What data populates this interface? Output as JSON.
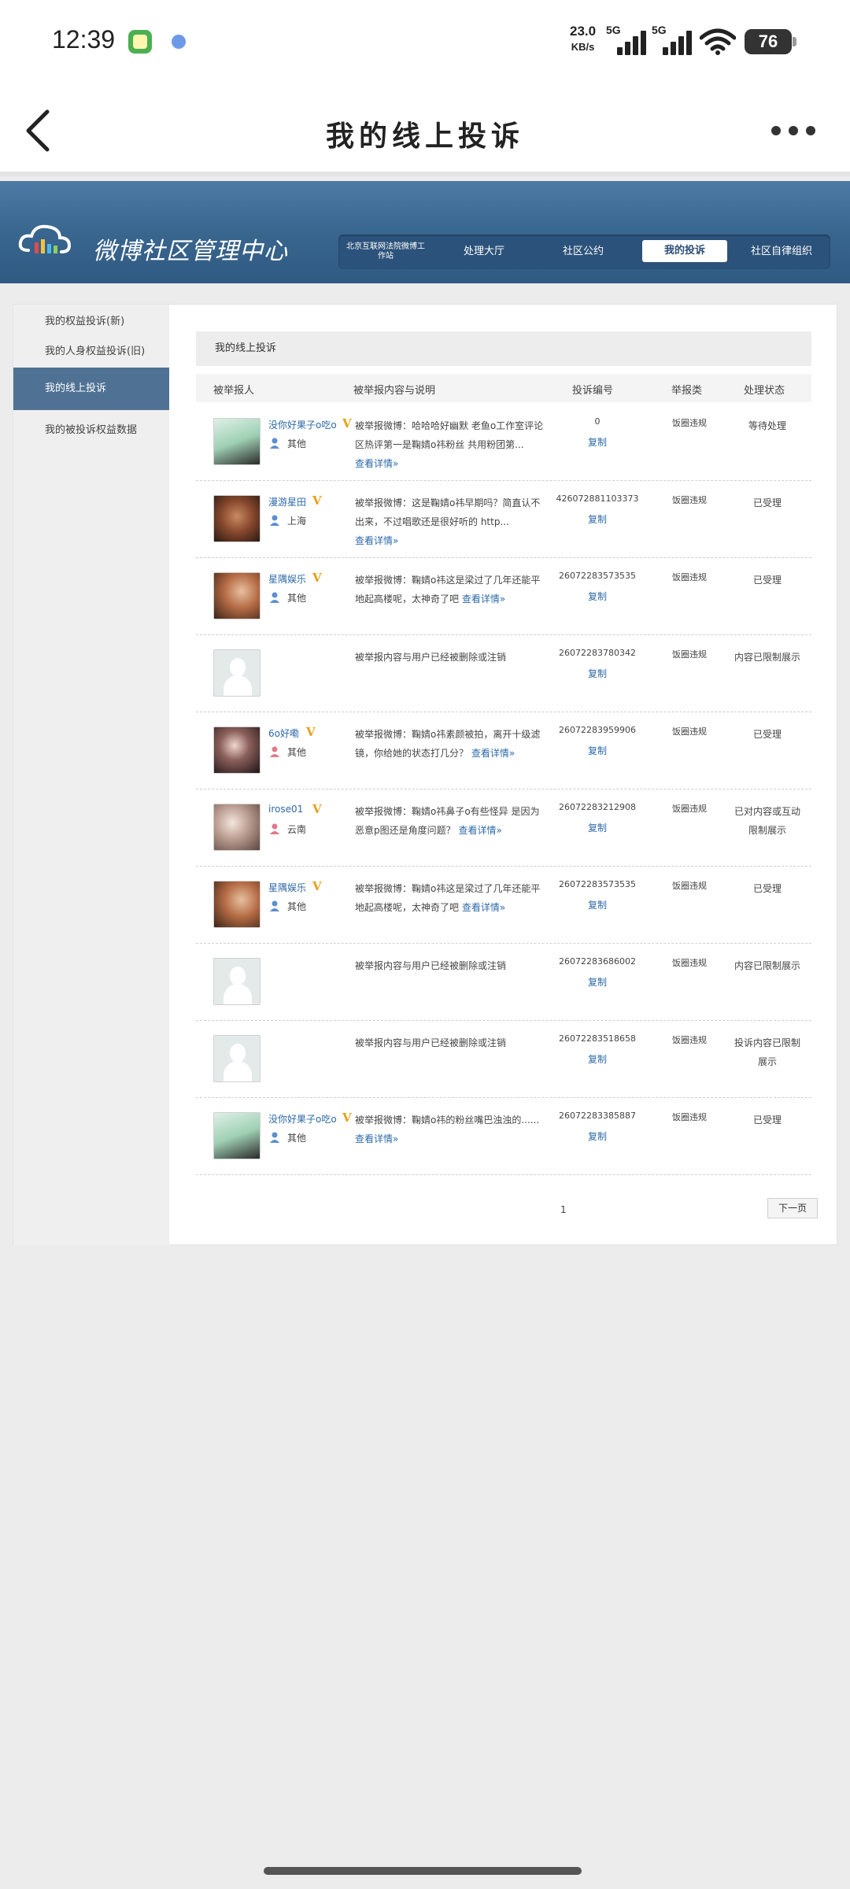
{
  "status_bar": {
    "time": "12:39",
    "net_speed_value": "23.0",
    "net_speed_unit": "KB/s",
    "net_type_1": "5G",
    "net_type_2": "5G",
    "battery": "76"
  },
  "app_bar": {
    "title": "我的线上投诉"
  },
  "banner": {
    "logo_text": "微博社区管理中心",
    "nav": [
      "北京互联网法院微博工作站",
      "处理大厅",
      "社区公约",
      "我的投诉",
      "社区自律组织"
    ],
    "active_nav": "我的投诉"
  },
  "sidebar": {
    "items": [
      "我的权益投诉(新)",
      "我的人身权益投诉(旧)",
      "我的线上投诉",
      "我的被投诉权益数据"
    ]
  },
  "content": {
    "section_title": "我的线上投诉",
    "columns": [
      "被举报人",
      "被举报内容与说明",
      "投诉编号",
      "举报类",
      "处理状态"
    ],
    "copy_label": "复制",
    "detail_label": "查看详情»",
    "rows": [
      {
        "name": "没你好果子o吃o",
        "location": "其他",
        "desc": "被举报微博：哈哈哈好幽默 老鱼o工作室评论区热评第一是鞠婧o祎粉丝 共用粉团第...",
        "has_detail": true,
        "no": "0",
        "type": "饭圈违规",
        "status": "等待处理"
      },
      {
        "name": "漫游星田",
        "location": "上海",
        "desc": "被举报微博：这是鞠婧o祎早期吗？简直认不出来，不过唱歌还是很好听的 http...",
        "has_detail": true,
        "no": "426072881103373",
        "type": "饭圈违规",
        "status": "已受理"
      },
      {
        "name": "星隅娱乐",
        "location": "其他",
        "desc": "被举报微博：鞠婧o祎这是梁过了几年还能平地起高楼呢，太神奇了吧",
        "has_detail": true,
        "no": "26072283573535",
        "type": "饭圈违规",
        "status": "已受理"
      },
      {
        "name": "",
        "location": "",
        "desc": "被举报内容与用户已经被删除或注销",
        "has_detail": false,
        "no": "26072283780342",
        "type": "饭圈违规",
        "status": "内容已限制展示"
      },
      {
        "name": "6o好嘞",
        "location": "其他",
        "desc": "被举报微博：鞠婧o祎素颜被拍，离开十级滤镜，你给她的状态打几分？",
        "has_detail": true,
        "no": "26072283959906",
        "type": "饭圈违规",
        "status": "已受理"
      },
      {
        "name": "irose01",
        "location": "云南",
        "desc": "被举报微博：鞠婧o祎鼻子o有些怪异 是因为恶意p图还是角度问题？",
        "has_detail": true,
        "no": "26072283212908",
        "type": "饭圈违规",
        "status": "已对内容或互动限制展示"
      },
      {
        "name": "星隅娱乐",
        "location": "其他",
        "desc": "被举报微博：鞠婧o祎这是梁过了几年还能平地起高楼呢，太神奇了吧",
        "has_detail": true,
        "no": "26072283573535",
        "type": "饭圈违规",
        "status": "已受理"
      },
      {
        "name": "",
        "location": "",
        "desc": "被举报内容与用户已经被删除或注销",
        "has_detail": false,
        "no": "26072283686002",
        "type": "饭圈违规",
        "status": "内容已限制展示"
      },
      {
        "name": "",
        "location": "",
        "desc": "被举报内容与用户已经被删除或注销",
        "has_detail": false,
        "no": "26072283518658",
        "type": "饭圈违规",
        "status": "投诉内容已限制展示"
      },
      {
        "name": "没你好果子o吃o",
        "location": "其他",
        "desc": "被举报微博：鞠婧o祎的粉丝嘴巴浊浊的......",
        "has_detail": true,
        "no": "26072283385887",
        "type": "饭圈违规",
        "status": "已受理"
      }
    ],
    "pager": {
      "page": "1",
      "next_label": "下一页"
    }
  }
}
